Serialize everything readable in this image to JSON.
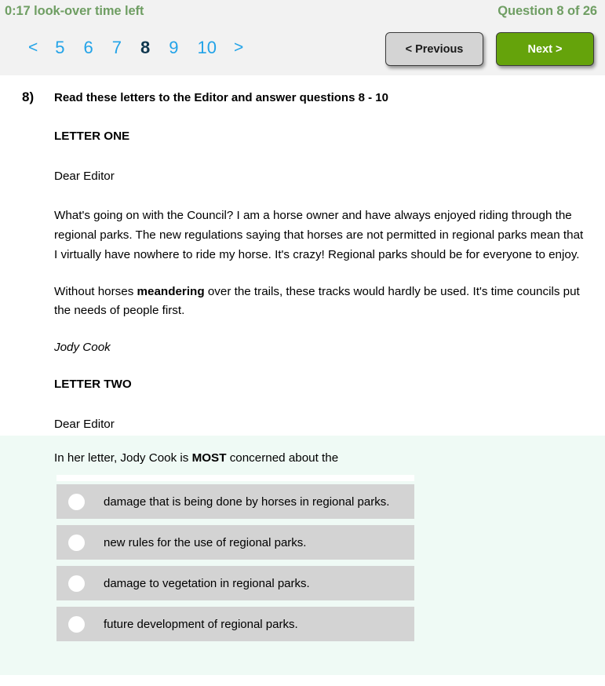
{
  "header": {
    "timer": "0:17 look-over time left",
    "question_counter": "Question 8 of 26",
    "accent_green": "#6f9e63",
    "link_blue": "#22a3e8",
    "current_page_color": "#10384f"
  },
  "pager": {
    "prev_arrow": "<",
    "next_arrow": ">",
    "pages": [
      "5",
      "6",
      "7",
      "8",
      "9",
      "10"
    ],
    "current_page": "8"
  },
  "nav": {
    "previous_label": "< Previous",
    "next_label": "Next >",
    "next_bg": "#65a30b",
    "previous_bg": "#d4d4d4"
  },
  "question": {
    "number": "8)",
    "stem": "Read these letters to the Editor and answer questions 8 - 10"
  },
  "passage": {
    "letter_one_heading": "LETTER ONE",
    "salutation": "Dear Editor",
    "para1": "What's going on with the Council? I am a horse owner and have always enjoyed riding through the regional parks. The new regulations saying that horses are not permitted in regional parks mean that I virtually have nowhere to ride my horse. It's crazy! Regional parks should be for everyone to enjoy.",
    "para2_before": "Without horses ",
    "para2_bold": "meandering",
    "para2_after": " over the trails, these tracks would hardly be used. It's time councils put the needs of people first.",
    "signature": "Jody Cook",
    "letter_two_heading": "LETTER TWO",
    "letter_two_salutation": "Dear Editor"
  },
  "answer": {
    "prompt_before": "In her letter, Jody Cook is ",
    "prompt_bold": "MOST",
    "prompt_after": " concerned about the",
    "panel_bg": "#effaf5",
    "option_bg": "#d3d3d3",
    "options": [
      {
        "label": "damage that is being done by horses in regional parks.",
        "selected": false
      },
      {
        "label": "new rules for the use of regional parks.",
        "selected": false
      },
      {
        "label": "damage to vegetation in regional parks.",
        "selected": false
      },
      {
        "label": "future development of regional parks.",
        "selected": false
      }
    ]
  }
}
